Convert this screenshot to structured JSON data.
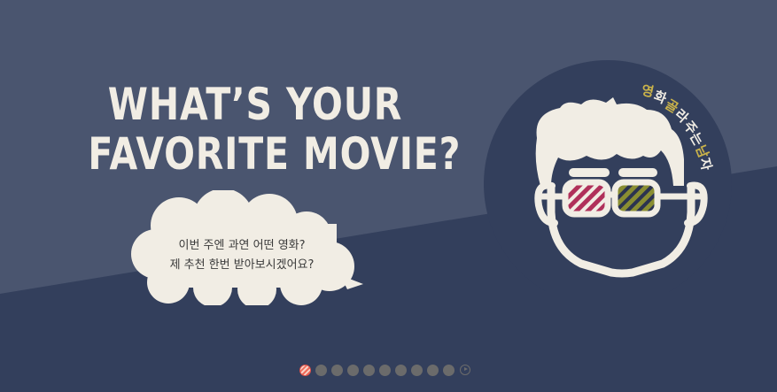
{
  "banner": {
    "headline_line1": "WHAT’S YOUR",
    "headline_line2": "FAVORITE MOVIE?",
    "bubble_line1": "이번 주엔 과연 어떤 영화?",
    "bubble_line2": "제 추천 한번 받아보시겠어요?",
    "brand_letters": [
      "영",
      "화",
      "골",
      "라",
      "주",
      "는",
      "남",
      "자"
    ],
    "brand_accent_letters": [
      "영",
      "골",
      "남"
    ]
  },
  "colors": {
    "bg_top": "#4a556f",
    "bg_bottom": "#333f5c",
    "cream": "#f1ede4",
    "lens_left": "#b0305a",
    "lens_right": "#8a8e32",
    "brand_gold": "#c9b24a",
    "active_dot": "#ef6b5a",
    "inactive_dot": "#6b6b6b"
  },
  "pager": {
    "total_slides": 10,
    "current_slide": 1,
    "play_icon": "play-icon"
  }
}
